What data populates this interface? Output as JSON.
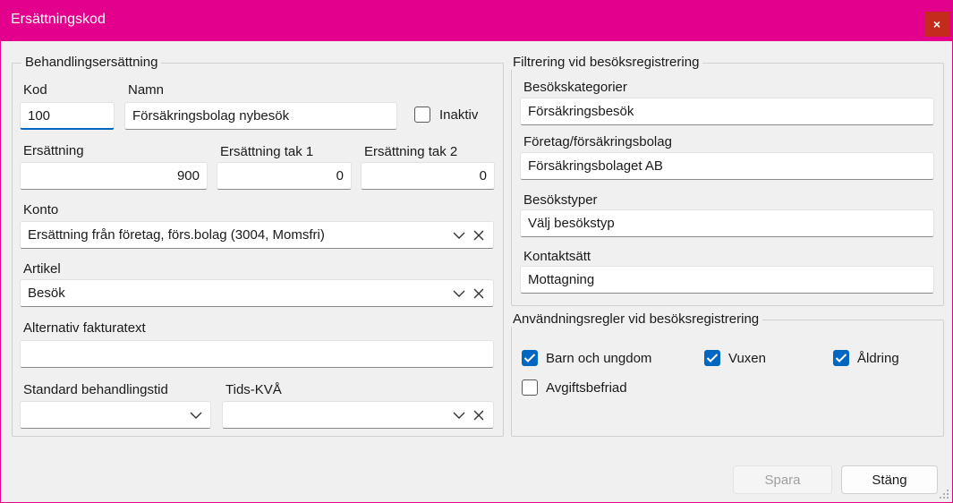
{
  "window": {
    "title": "Ersättningskod",
    "close_label": "×"
  },
  "left_group": {
    "legend": "Behandlingsersättning",
    "kod": {
      "label": "Kod",
      "value": "100"
    },
    "namn": {
      "label": "Namn",
      "value": "Försäkringsbolag nybesök"
    },
    "inaktiv": {
      "label": "Inaktiv",
      "checked": false
    },
    "ersattning": {
      "label": "Ersättning",
      "value": "900"
    },
    "tak1": {
      "label": "Ersättning tak 1",
      "value": "0"
    },
    "tak2": {
      "label": "Ersättning tak 2",
      "value": "0"
    },
    "konto": {
      "label": "Konto",
      "value": "Ersättning från företag, förs.bolag (3004, Momsfri)"
    },
    "artikel": {
      "label": "Artikel",
      "value": "Besök"
    },
    "alt_fakturatext": {
      "label": "Alternativ fakturatext",
      "value": ""
    },
    "standard_behandlingstid": {
      "label": "Standard behandlingstid",
      "value": ""
    },
    "tids_kva": {
      "label": "Tids-KVÅ",
      "value": ""
    }
  },
  "filter_group": {
    "legend": "Filtrering vid besöksregistrering",
    "besokskategorier": {
      "label": "Besökskategorier",
      "value": "Försäkringsbesök"
    },
    "foretag": {
      "label": "Företag/försäkringsbolag",
      "value": "Försäkringsbolaget AB"
    },
    "besokstyper": {
      "label": "Besökstyper",
      "value": "Välj besökstyp"
    },
    "kontaktsatt": {
      "label": "Kontaktsätt",
      "value": "Mottagning"
    }
  },
  "rules_group": {
    "legend": "Användningsregler vid besöksregistrering",
    "barn": {
      "label": "Barn och ungdom",
      "checked": true
    },
    "vuxen": {
      "label": "Vuxen",
      "checked": true
    },
    "aldring": {
      "label": "Åldring",
      "checked": true
    },
    "avgiftsbefriad": {
      "label": "Avgiftsbefriad",
      "checked": false
    }
  },
  "buttons": {
    "spara": "Spara",
    "stang": "Stäng"
  },
  "colors": {
    "titlebar": "#e3008c",
    "accent": "#0067c0",
    "close": "#c42b1c"
  },
  "icons": {
    "dropdown": "chevron-down-icon",
    "clear": "clear-icon",
    "checkbox": "checkmark-icon",
    "resize": "resize-grip-icon"
  }
}
